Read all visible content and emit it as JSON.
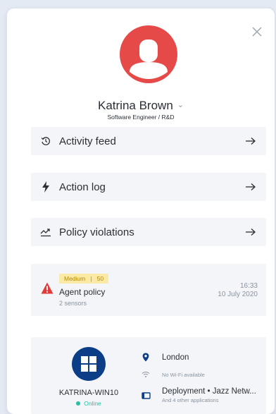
{
  "profile": {
    "name": "Katrina Brown",
    "role": "Software Engineer / R&D"
  },
  "nav": [
    {
      "label": "Activity feed",
      "icon": "history-icon"
    },
    {
      "label": "Action log",
      "icon": "lightning-icon"
    },
    {
      "label": "Policy violations",
      "icon": "trend-up-icon"
    }
  ],
  "alert": {
    "badge": "Medium   |   50",
    "title": "Agent policy",
    "subtitle": "2 sensors",
    "time": "16:33",
    "date": "10 July 2020",
    "icon": "warning-icon",
    "color": "#e03b3b"
  },
  "device": {
    "hostname": "KATRINA-WIN10",
    "status": "Online",
    "status_color": "#2dbda0",
    "location": "London",
    "wifi": "No Wi-Fi available",
    "apps": "Deployment • Jazz Netw...",
    "apps_more": "And 4 other applications"
  },
  "colors": {
    "accent": "#0c3e87",
    "avatar_bg": "#e64a48"
  }
}
